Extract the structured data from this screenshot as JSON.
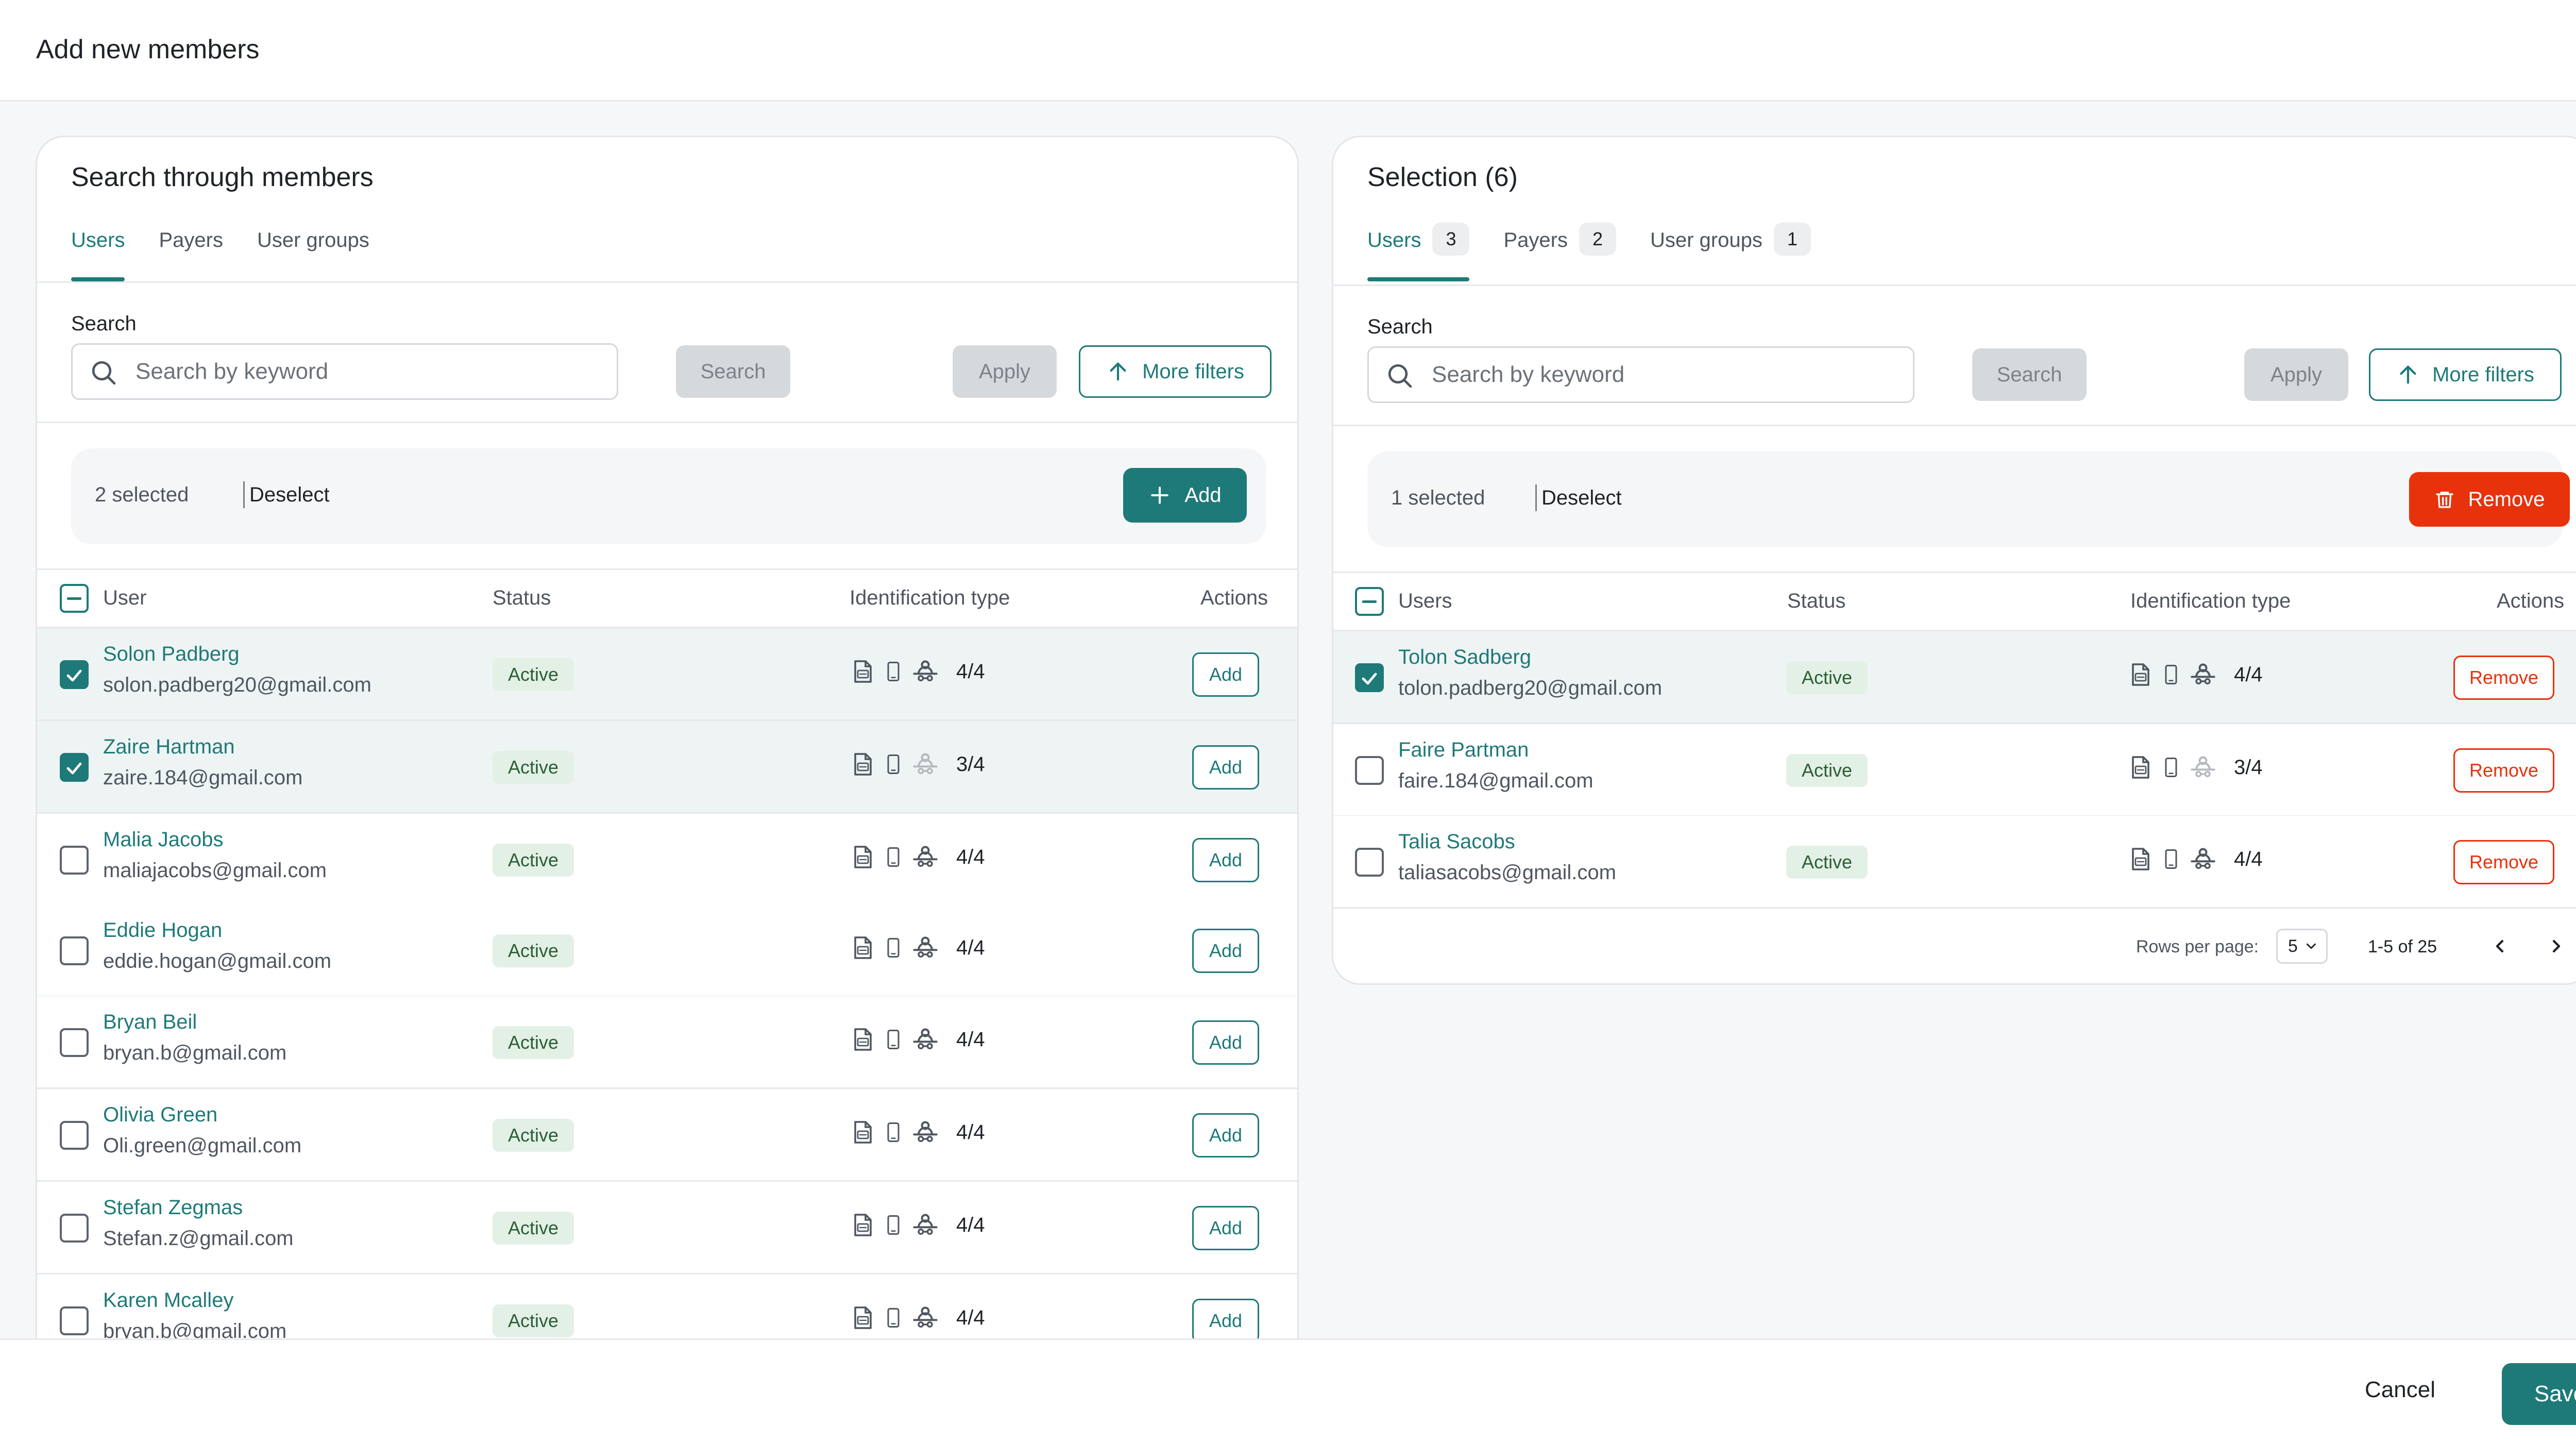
{
  "modal": {
    "title": "Add new members"
  },
  "left": {
    "title": "Search through members",
    "tabs": [
      {
        "label": "Users"
      },
      {
        "label": "Payers"
      },
      {
        "label": "User groups"
      }
    ],
    "search": {
      "label": "Search",
      "placeholder": "Search by keyword",
      "button": "Search",
      "apply": "Apply",
      "more_filters": "More filters"
    },
    "selection": {
      "count": "2 selected",
      "deselect": "Deselect",
      "add_button": "Add"
    },
    "columns": {
      "user": "User",
      "status": "Status",
      "id_type": "Identification type",
      "actions": "Actions"
    },
    "rows": [
      {
        "name": "Solon Padberg",
        "email": "solon.padberg20@gmail.com",
        "status": "Active",
        "id_count": "4/4",
        "action": "Add",
        "checked": true
      },
      {
        "name": "Zaire Hartman",
        "email": "zaire.184@gmail.com",
        "status": "Active",
        "id_count": "3/4",
        "action": "Add",
        "checked": true
      },
      {
        "name": "Malia Jacobs",
        "email": "maliajacobs@gmail.com",
        "status": "Active",
        "id_count": "4/4",
        "action": "Add",
        "checked": false
      },
      {
        "name": "Eddie Hogan",
        "email": "eddie.hogan@gmail.com",
        "status": "Active",
        "id_count": "4/4",
        "action": "Add",
        "checked": false
      },
      {
        "name": "Bryan Beil",
        "email": "bryan.b@gmail.com",
        "status": "Active",
        "id_count": "4/4",
        "action": "Add",
        "checked": false
      },
      {
        "name": "Olivia Green",
        "email": "Oli.green@gmail.com",
        "status": "Active",
        "id_count": "4/4",
        "action": "Add",
        "checked": false
      },
      {
        "name": "Stefan Zegmas",
        "email": "Stefan.z@gmail.com",
        "status": "Active",
        "id_count": "4/4",
        "action": "Add",
        "checked": false
      },
      {
        "name": "Karen Mcalley",
        "email": "bryan.b@gmail.com",
        "status": "Active",
        "id_count": "4/4",
        "action": "Add",
        "checked": false
      }
    ]
  },
  "right": {
    "title": "Selection (6)",
    "tabs": [
      {
        "label": "Users",
        "count": "3"
      },
      {
        "label": "Payers",
        "count": "2"
      },
      {
        "label": "User groups",
        "count": "1"
      }
    ],
    "search": {
      "label": "Search",
      "placeholder": "Search by keyword",
      "button": "Search",
      "apply": "Apply",
      "more_filters": "More filters"
    },
    "selection": {
      "count": "1 selected",
      "deselect": "Deselect",
      "remove_button": "Remove"
    },
    "columns": {
      "user": "Users",
      "status": "Status",
      "id_type": "Identification type",
      "actions": "Actions"
    },
    "rows": [
      {
        "name": "Tolon Sadberg",
        "email": "tolon.padberg20@gmail.com",
        "status": "Active",
        "id_count": "4/4",
        "action": "Remove",
        "checked": true
      },
      {
        "name": "Faire Partman",
        "email": "faire.184@gmail.com",
        "status": "Active",
        "id_count": "3/4",
        "action": "Remove",
        "checked": false
      },
      {
        "name": "Talia Sacobs",
        "email": "taliasacobs@gmail.com",
        "status": "Active",
        "id_count": "4/4",
        "action": "Remove",
        "checked": false
      }
    ],
    "pagination": {
      "rows_label": "Rows per page:",
      "rows_value": "5",
      "range": "1-5 of 25"
    }
  },
  "footer": {
    "cancel": "Cancel",
    "save": "Save"
  },
  "colors": {
    "accent": "#1e7a78",
    "danger": "#e8320c",
    "status_bg": "#e3f0e6",
    "row_selected": "#eef4f4"
  },
  "icons": [
    "search-icon",
    "arrow-up-icon",
    "plus-icon",
    "trash-icon",
    "doc-id-icon",
    "phone-icon",
    "face-id-icon",
    "chevron-down-icon",
    "chevron-left-icon",
    "chevron-right-icon",
    "check-icon"
  ]
}
